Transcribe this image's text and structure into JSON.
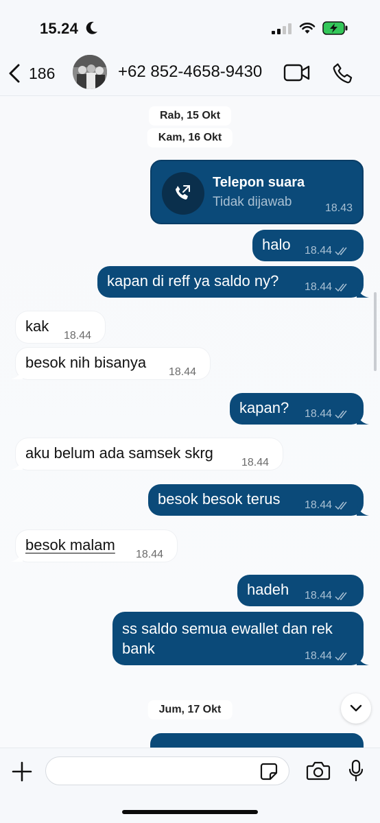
{
  "status_bar": {
    "time": "15.24"
  },
  "header": {
    "back_count": "186",
    "contact_name": "+62 852-4658-9430"
  },
  "chat": {
    "dates": [
      "Rab, 15 Okt",
      "Kam, 16 Okt",
      "Jum, 17 Okt"
    ],
    "call": {
      "title": "Telepon suara",
      "status": "Tidak dijawab",
      "time": "18.43"
    },
    "messages": [
      {
        "dir": "out",
        "text": "halo",
        "time": "18.44"
      },
      {
        "dir": "out",
        "text": "kapan di reff ya saldo ny?",
        "time": "18.44"
      },
      {
        "dir": "in",
        "text": "kak",
        "time": "18.44"
      },
      {
        "dir": "in",
        "text": "besok nih bisanya",
        "time": "18.44"
      },
      {
        "dir": "out",
        "text": "kapan?",
        "time": "18.44"
      },
      {
        "dir": "in",
        "text": "aku belum ada samsek skrg",
        "time": "18.44"
      },
      {
        "dir": "out",
        "text": "besok besok terus",
        "time": "18.44"
      },
      {
        "dir": "in",
        "text": "besok malam",
        "time": "18.44"
      },
      {
        "dir": "out",
        "text": "hadeh",
        "time": "18.44"
      },
      {
        "dir": "out",
        "text": "ss saldo semua ewallet dan rek",
        "text2": "bank",
        "time": "18.44"
      }
    ]
  },
  "input": {
    "placeholder": ""
  },
  "colors": {
    "outgoing_bubble": "#0b4a79",
    "incoming_bubble": "#ffffff",
    "accent": "#0b4a79"
  },
  "icons": [
    "moon-icon",
    "signal-icon",
    "wifi-icon",
    "battery-charging-icon",
    "back-chevron-icon",
    "video-call-icon",
    "phone-icon",
    "outgoing-call-icon",
    "double-check-icon",
    "chevron-down-icon",
    "plus-icon",
    "sticker-icon",
    "camera-icon",
    "mic-icon"
  ]
}
